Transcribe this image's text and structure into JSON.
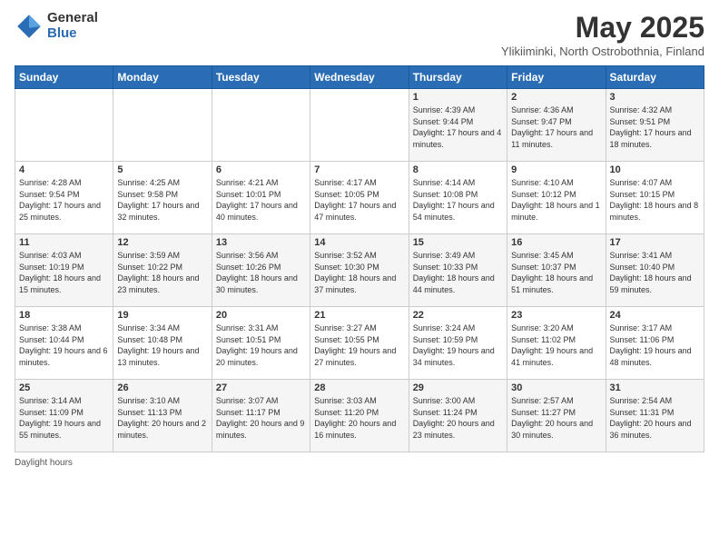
{
  "logo": {
    "general": "General",
    "blue": "Blue"
  },
  "title": "May 2025",
  "subtitle": "Ylikiiminki, North Ostrobothnia, Finland",
  "footer": "Daylight hours",
  "days_header": [
    "Sunday",
    "Monday",
    "Tuesday",
    "Wednesday",
    "Thursday",
    "Friday",
    "Saturday"
  ],
  "weeks": [
    [
      {
        "day": "",
        "info": ""
      },
      {
        "day": "",
        "info": ""
      },
      {
        "day": "",
        "info": ""
      },
      {
        "day": "",
        "info": ""
      },
      {
        "day": "1",
        "info": "Sunrise: 4:39 AM\nSunset: 9:44 PM\nDaylight: 17 hours\nand 4 minutes."
      },
      {
        "day": "2",
        "info": "Sunrise: 4:36 AM\nSunset: 9:47 PM\nDaylight: 17 hours\nand 11 minutes."
      },
      {
        "day": "3",
        "info": "Sunrise: 4:32 AM\nSunset: 9:51 PM\nDaylight: 17 hours\nand 18 minutes."
      }
    ],
    [
      {
        "day": "4",
        "info": "Sunrise: 4:28 AM\nSunset: 9:54 PM\nDaylight: 17 hours\nand 25 minutes."
      },
      {
        "day": "5",
        "info": "Sunrise: 4:25 AM\nSunset: 9:58 PM\nDaylight: 17 hours\nand 32 minutes."
      },
      {
        "day": "6",
        "info": "Sunrise: 4:21 AM\nSunset: 10:01 PM\nDaylight: 17 hours\nand 40 minutes."
      },
      {
        "day": "7",
        "info": "Sunrise: 4:17 AM\nSunset: 10:05 PM\nDaylight: 17 hours\nand 47 minutes."
      },
      {
        "day": "8",
        "info": "Sunrise: 4:14 AM\nSunset: 10:08 PM\nDaylight: 17 hours\nand 54 minutes."
      },
      {
        "day": "9",
        "info": "Sunrise: 4:10 AM\nSunset: 10:12 PM\nDaylight: 18 hours\nand 1 minute."
      },
      {
        "day": "10",
        "info": "Sunrise: 4:07 AM\nSunset: 10:15 PM\nDaylight: 18 hours\nand 8 minutes."
      }
    ],
    [
      {
        "day": "11",
        "info": "Sunrise: 4:03 AM\nSunset: 10:19 PM\nDaylight: 18 hours\nand 15 minutes."
      },
      {
        "day": "12",
        "info": "Sunrise: 3:59 AM\nSunset: 10:22 PM\nDaylight: 18 hours\nand 23 minutes."
      },
      {
        "day": "13",
        "info": "Sunrise: 3:56 AM\nSunset: 10:26 PM\nDaylight: 18 hours\nand 30 minutes."
      },
      {
        "day": "14",
        "info": "Sunrise: 3:52 AM\nSunset: 10:30 PM\nDaylight: 18 hours\nand 37 minutes."
      },
      {
        "day": "15",
        "info": "Sunrise: 3:49 AM\nSunset: 10:33 PM\nDaylight: 18 hours\nand 44 minutes."
      },
      {
        "day": "16",
        "info": "Sunrise: 3:45 AM\nSunset: 10:37 PM\nDaylight: 18 hours\nand 51 minutes."
      },
      {
        "day": "17",
        "info": "Sunrise: 3:41 AM\nSunset: 10:40 PM\nDaylight: 18 hours\nand 59 minutes."
      }
    ],
    [
      {
        "day": "18",
        "info": "Sunrise: 3:38 AM\nSunset: 10:44 PM\nDaylight: 19 hours\nand 6 minutes."
      },
      {
        "day": "19",
        "info": "Sunrise: 3:34 AM\nSunset: 10:48 PM\nDaylight: 19 hours\nand 13 minutes."
      },
      {
        "day": "20",
        "info": "Sunrise: 3:31 AM\nSunset: 10:51 PM\nDaylight: 19 hours\nand 20 minutes."
      },
      {
        "day": "21",
        "info": "Sunrise: 3:27 AM\nSunset: 10:55 PM\nDaylight: 19 hours\nand 27 minutes."
      },
      {
        "day": "22",
        "info": "Sunrise: 3:24 AM\nSunset: 10:59 PM\nDaylight: 19 hours\nand 34 minutes."
      },
      {
        "day": "23",
        "info": "Sunrise: 3:20 AM\nSunset: 11:02 PM\nDaylight: 19 hours\nand 41 minutes."
      },
      {
        "day": "24",
        "info": "Sunrise: 3:17 AM\nSunset: 11:06 PM\nDaylight: 19 hours\nand 48 minutes."
      }
    ],
    [
      {
        "day": "25",
        "info": "Sunrise: 3:14 AM\nSunset: 11:09 PM\nDaylight: 19 hours\nand 55 minutes."
      },
      {
        "day": "26",
        "info": "Sunrise: 3:10 AM\nSunset: 11:13 PM\nDaylight: 20 hours\nand 2 minutes."
      },
      {
        "day": "27",
        "info": "Sunrise: 3:07 AM\nSunset: 11:17 PM\nDaylight: 20 hours\nand 9 minutes."
      },
      {
        "day": "28",
        "info": "Sunrise: 3:03 AM\nSunset: 11:20 PM\nDaylight: 20 hours\nand 16 minutes."
      },
      {
        "day": "29",
        "info": "Sunrise: 3:00 AM\nSunset: 11:24 PM\nDaylight: 20 hours\nand 23 minutes."
      },
      {
        "day": "30",
        "info": "Sunrise: 2:57 AM\nSunset: 11:27 PM\nDaylight: 20 hours\nand 30 minutes."
      },
      {
        "day": "31",
        "info": "Sunrise: 2:54 AM\nSunset: 11:31 PM\nDaylight: 20 hours\nand 36 minutes."
      }
    ]
  ]
}
